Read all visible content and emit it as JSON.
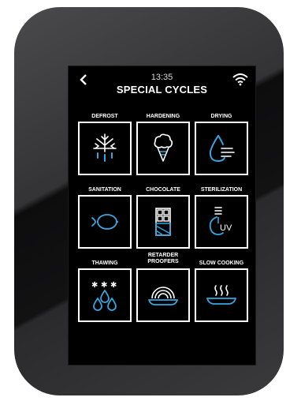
{
  "header": {
    "time": "13:35",
    "title": "SPECIAL CYCLES"
  },
  "cycles": [
    {
      "label": "DEFROST",
      "icon": "defrost-icon"
    },
    {
      "label": "HARDENING",
      "icon": "ice-cream-icon"
    },
    {
      "label": "DRYING",
      "icon": "drop-icon"
    },
    {
      "label": "SANITATION",
      "icon": "lemon-icon"
    },
    {
      "label": "CHOCOLATE",
      "icon": "chocolate-icon"
    },
    {
      "label": "STERILIZATION",
      "icon": "uv-lamp-icon",
      "icon_text": "UV"
    },
    {
      "label": "THAWING",
      "icon": "thawing-icon"
    },
    {
      "label": "RETARDER\nPROOFERS",
      "icon": "bread-icon"
    },
    {
      "label": "SLOW COOKING",
      "icon": "steaming-plate-icon"
    }
  ],
  "colors": {
    "icon_accent": "#36a6e0",
    "frame": "#ffffff",
    "screen_bg": "#000000"
  }
}
